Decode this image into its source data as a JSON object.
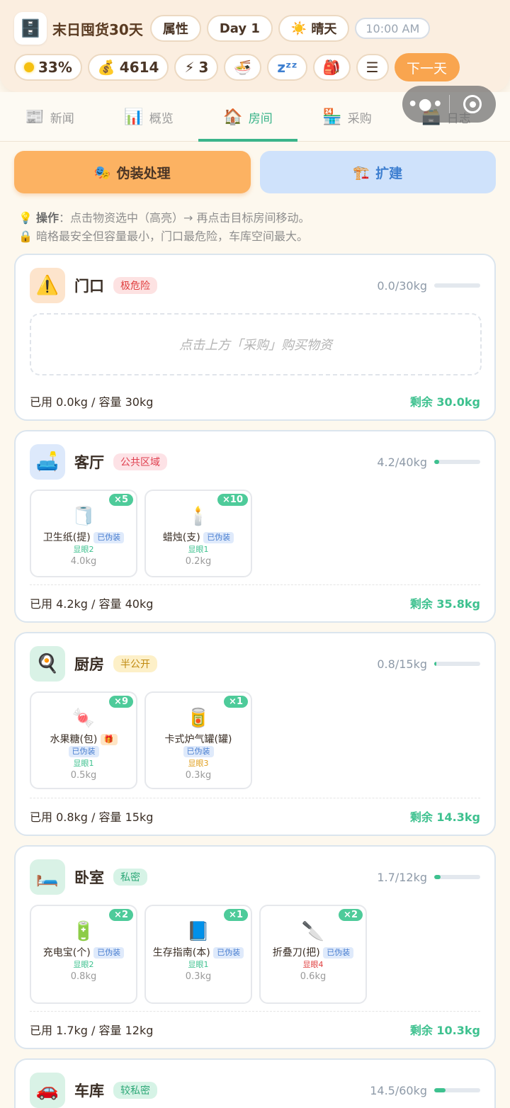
{
  "header": {
    "app_icon": "cabinet-icon",
    "title": "末日囤货30天",
    "attr_label": "属性",
    "day_label": "Day 1",
    "weather_icon": "sun-icon",
    "weather_label": "晴天",
    "time": "10:00 AM",
    "status": [
      {
        "icon": "sun-dot-icon",
        "value": "33%"
      },
      {
        "icon": "money-bag-icon",
        "value": "4614"
      },
      {
        "icon": "lightning-icon",
        "value": "3"
      }
    ],
    "quick_buttons": [
      "noodle-bowl-icon",
      "sleep-icon",
      "backpack-icon",
      "menu-icon"
    ],
    "next_day_label": "下一天"
  },
  "tabs": [
    {
      "label": "新闻",
      "icon": "newspaper-icon",
      "active": false
    },
    {
      "label": "概览",
      "icon": "bar-chart-icon",
      "active": false
    },
    {
      "label": "房间",
      "icon": "house-icon",
      "active": true
    },
    {
      "label": "采购",
      "icon": "store-icon",
      "active": false
    },
    {
      "label": "日志",
      "icon": "log-icon",
      "active": false
    }
  ],
  "actions": {
    "disguise_label": "伪装处理",
    "expand_label": "扩建"
  },
  "tips": {
    "line1_bold": "操作",
    "line1": "：点击物资选中（高亮）→ 再点击目标房间移动。",
    "line2": "暗格最安全但容量最小，门口最危险，车库空间最大。"
  },
  "rooms": [
    {
      "name": "门口",
      "tag": "极危险",
      "capacity": "0.0/30kg",
      "fill": 0,
      "empty_hint": "点击上方「采购」购买物资",
      "used": "已用 0.0kg / 容量 30kg",
      "remaining": "剩余 30.0kg",
      "items": []
    },
    {
      "name": "客厅",
      "tag": "公共区域",
      "capacity": "4.2/40kg",
      "fill": 0.105,
      "used": "已用 4.2kg / 容量 40kg",
      "remaining": "剩余 35.8kg",
      "items": [
        {
          "name": "卫生纸(提)",
          "count": "×5",
          "badge": "已伪装",
          "visibility": "显眼2",
          "weight": "4.0kg",
          "icon": "toilet-paper-icon"
        },
        {
          "name": "蜡烛(支)",
          "count": "×10",
          "badge": "已伪装",
          "visibility": "显眼1",
          "weight": "0.2kg",
          "icon": "candle-icon"
        }
      ]
    },
    {
      "name": "厨房",
      "tag": "半公开",
      "capacity": "0.8/15kg",
      "fill": 0.053,
      "used": "已用 0.8kg / 容量 15kg",
      "remaining": "剩余 14.3kg",
      "items": [
        {
          "name": "水果糖(包)",
          "count": "×9",
          "badge": "已伪装",
          "visibility": "显眼1",
          "weight": "0.5kg",
          "icon": "candy-icon"
        },
        {
          "name": "卡式炉气罐(罐)",
          "count": "×1",
          "badge": "已伪装",
          "visibility": "显眼3",
          "weight": "0.3kg",
          "icon": "gas-can-icon"
        }
      ]
    },
    {
      "name": "卧室",
      "tag": "私密",
      "capacity": "1.7/12kg",
      "fill": 0.14,
      "used": "已用 1.7kg / 容量 12kg",
      "remaining": "剩余 10.3kg",
      "items": [
        {
          "name": "充电宝(个)",
          "count": "×2",
          "badge": "已伪装",
          "visibility": "显眼2",
          "weight": "0.8kg",
          "icon": "power-bank-icon"
        },
        {
          "name": "生存指南(本)",
          "count": "×1",
          "badge": "已伪装",
          "visibility": "显眼1",
          "weight": "0.3kg",
          "icon": "guide-book-icon"
        },
        {
          "name": "折叠刀(把)",
          "count": "×2",
          "badge": "已伪装",
          "visibility": "显眼4",
          "weight": "0.6kg",
          "icon": "folding-knife-icon"
        }
      ]
    },
    {
      "name": "车库",
      "tag": "较私密",
      "capacity": "14.5/60kg",
      "fill": 0.24,
      "items": []
    }
  ],
  "colors": {
    "accent": "#3bb48a",
    "orange": "#f9a54f",
    "danger": "#e04040",
    "visibility_low": "#3ec18f",
    "visibility_mid": "#e0a020"
  }
}
